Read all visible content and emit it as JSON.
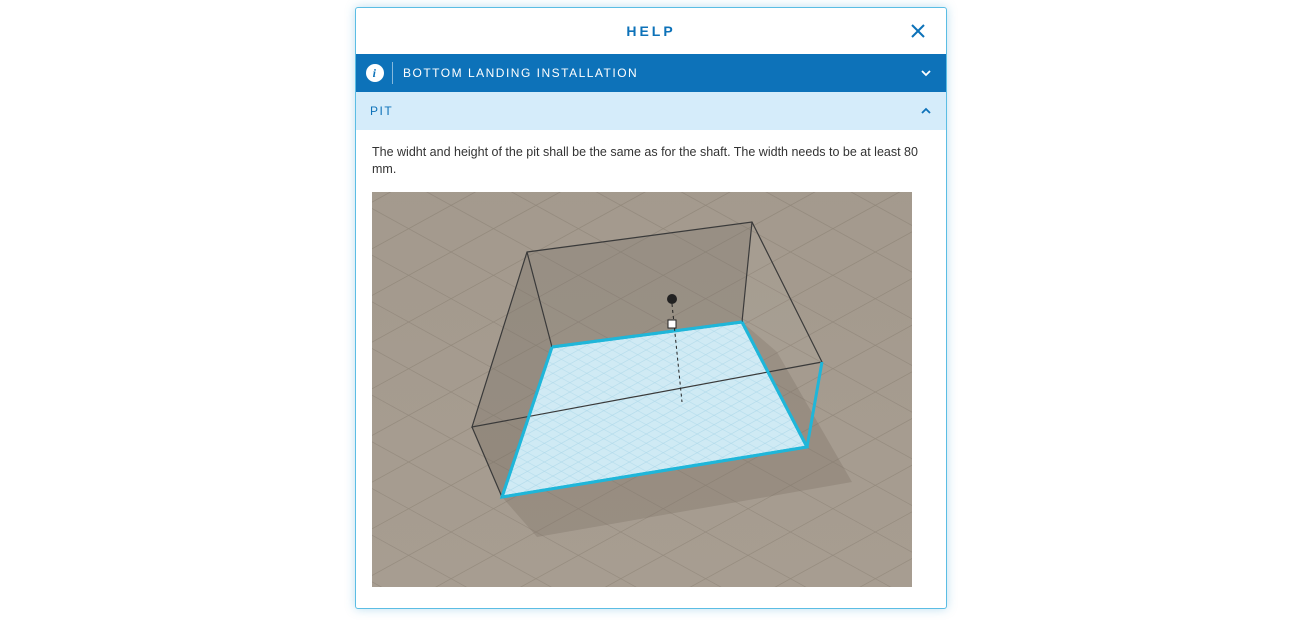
{
  "panel": {
    "title": "HELP"
  },
  "sections": {
    "main": {
      "label": "BOTTOM LANDING INSTALLATION",
      "expanded": false
    },
    "sub": {
      "label": "PIT",
      "expanded": true
    }
  },
  "body": {
    "text": "The widht and height of the pit shall be the same as for the shaft. The width needs to be at least 80 mm."
  },
  "icons": {
    "info": "i",
    "close": "close-icon",
    "chev_down": "chevron-down-icon",
    "chev_up": "chevron-up-icon"
  },
  "colors": {
    "accent": "#0d72b9",
    "light": "#d5ecfa",
    "edge_cyan": "#1fb6d9"
  }
}
